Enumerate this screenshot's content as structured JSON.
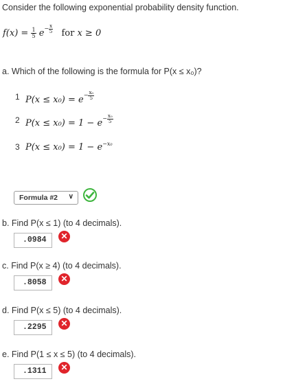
{
  "intro": "Consider the following exponential probability density function.",
  "pdf": {
    "lhs": "f(x) =",
    "frac_num": "1",
    "frac_den": "5",
    "base": "e",
    "exp_sign": "−",
    "exp_num": "x",
    "exp_den": "5",
    "cond": "for",
    "cond_expr": "x ≥ 0"
  },
  "question_a": "a. Which of the following is the formula for P(x ≤ x₀)?",
  "options": [
    {
      "num": "1",
      "lhs": "P(x ≤ x₀) =",
      "base": "e",
      "exp_num": "x₀",
      "exp_den": "5"
    },
    {
      "num": "2",
      "lhs": "P(x ≤ x₀) = 1 −",
      "base": "e",
      "exp_num": "x₀",
      "exp_den": "5"
    },
    {
      "num": "3",
      "lhs": "P(x ≤ x₀) = 1 −",
      "base": "e",
      "exp": "−x₀"
    }
  ],
  "select": {
    "value": "Formula #2",
    "chevron": "∨"
  },
  "questions": [
    {
      "label": "b. Find P(x ≤ 1) (to 4 decimals).",
      "answer": ".0984"
    },
    {
      "label": "c. Find P(x ≥ 4) (to 4 decimals).",
      "answer": ".8058"
    },
    {
      "label": "d. Find P(x ≤ 5) (to 4 decimals).",
      "answer": ".2295"
    },
    {
      "label": "e. Find P(1 ≤ x ≤ 5) (to 4 decimals).",
      "answer": ".1311"
    }
  ],
  "icons": {
    "correct": "check-circle-icon",
    "incorrect": "x-circle-icon",
    "correct_color": "#3db53d",
    "incorrect_color": "#e0242b"
  }
}
